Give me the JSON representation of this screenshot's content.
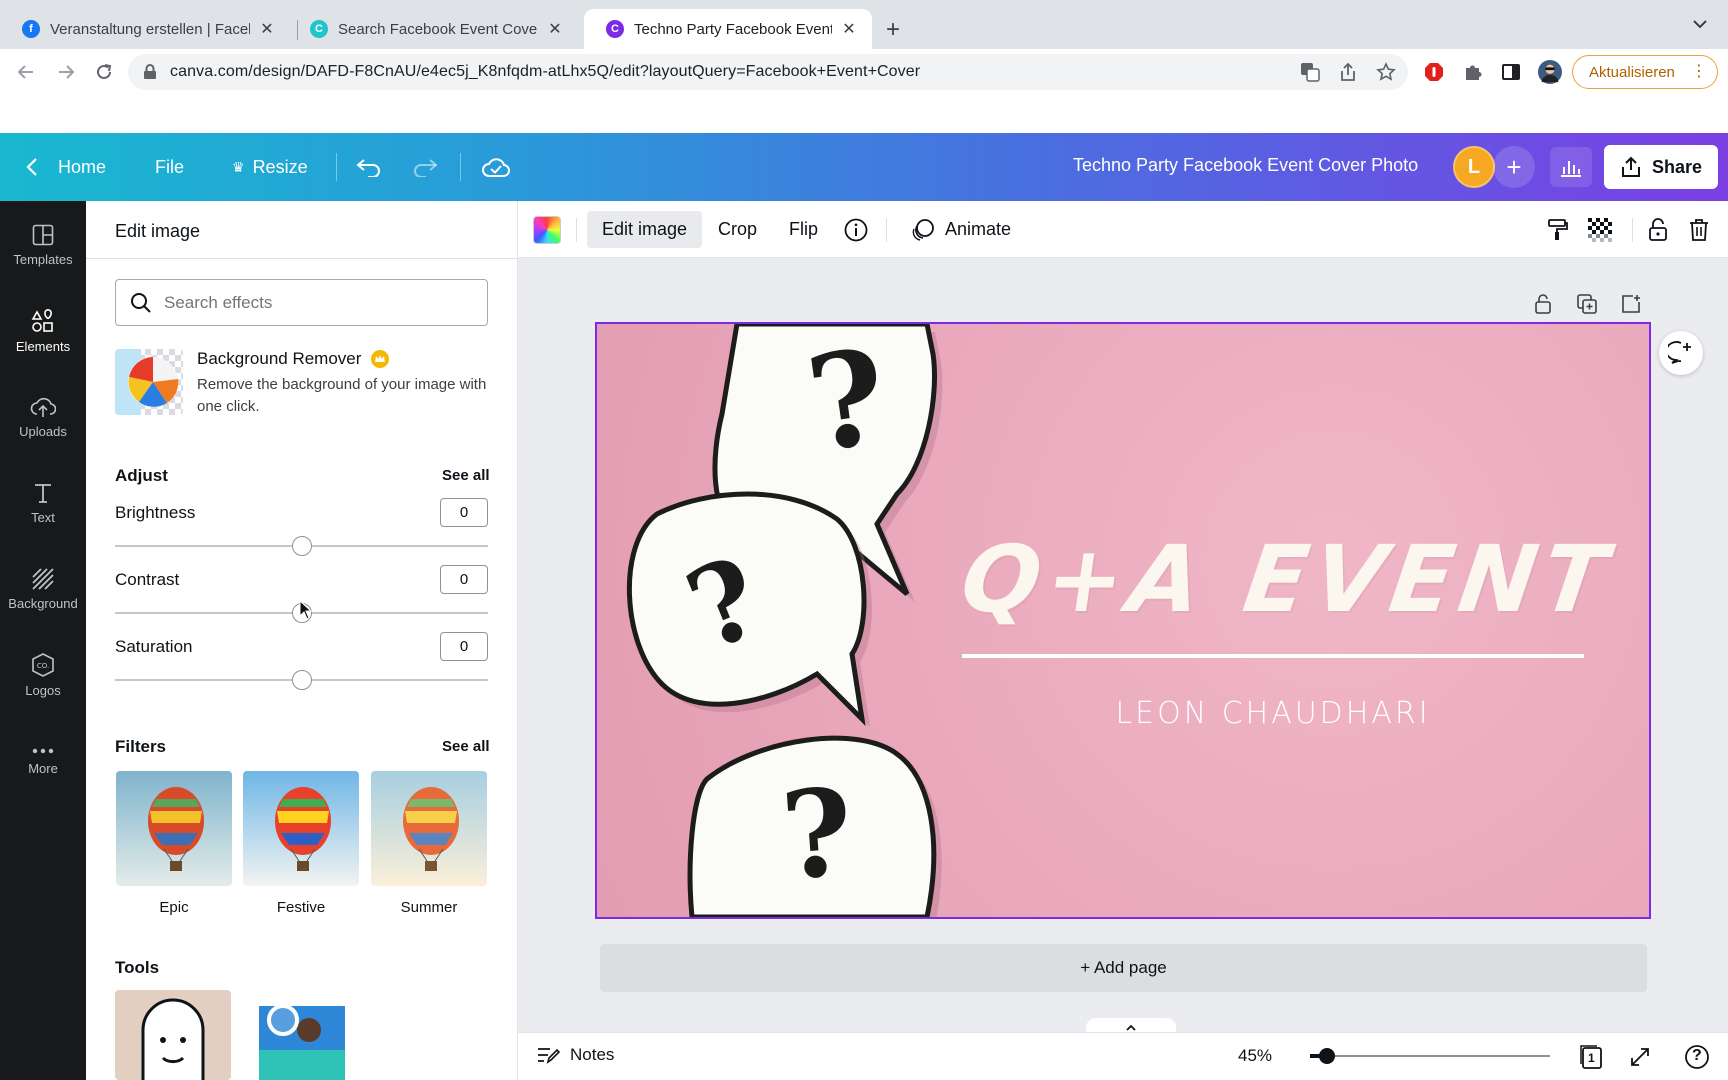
{
  "browser": {
    "tabs": [
      {
        "title": "Veranstaltung erstellen | Faceb",
        "favicon": "facebook-icon",
        "color": "#1877f2"
      },
      {
        "title": "Search Facebook Event Cover",
        "favicon": "canva-icon",
        "color": "#20c4cb"
      },
      {
        "title": "Techno Party Facebook Event C",
        "favicon": "canva-icon",
        "color": "#7d2ae8"
      }
    ],
    "url_host": "canva.com",
    "url_path": "/design/DAFD-F8CnAU/e4ec5j_K8nfqdm-atLhx5Q/edit?layoutQuery=Facebook+Event+Cover",
    "update_label": "Aktualisieren"
  },
  "header": {
    "home": "Home",
    "file": "File",
    "resize": "Resize",
    "doc_title": "Techno Party Facebook Event Cover Photo",
    "avatar_letter": "L",
    "share": "Share"
  },
  "rail": [
    {
      "label": "Templates",
      "icon": "templates-icon"
    },
    {
      "label": "Elements",
      "icon": "elements-icon"
    },
    {
      "label": "Uploads",
      "icon": "uploads-icon"
    },
    {
      "label": "Text",
      "icon": "text-icon"
    },
    {
      "label": "Background",
      "icon": "background-icon"
    },
    {
      "label": "Logos",
      "icon": "logos-icon"
    },
    {
      "label": "More",
      "icon": "more-icon"
    }
  ],
  "panel": {
    "title": "Edit image",
    "search_placeholder": "Search effects",
    "bg_remover": {
      "title": "Background Remover",
      "desc": "Remove the background of your image with one click."
    },
    "adjust": {
      "title": "Adjust",
      "see_all": "See all",
      "items": [
        {
          "label": "Brightness",
          "value": "0"
        },
        {
          "label": "Contrast",
          "value": "0"
        },
        {
          "label": "Saturation",
          "value": "0"
        }
      ]
    },
    "filters": {
      "title": "Filters",
      "see_all": "See all",
      "items": [
        "Epic",
        "Festive",
        "Summer"
      ]
    },
    "tools": {
      "title": "Tools"
    }
  },
  "toolbar": {
    "edit_image": "Edit image",
    "crop": "Crop",
    "flip": "Flip",
    "animate": "Animate"
  },
  "design": {
    "headline": "Q+A EVENT",
    "name": "LEON CHAUDHARI",
    "qmark": "?"
  },
  "canvas": {
    "add_page": "+ Add page"
  },
  "bottom": {
    "notes": "Notes",
    "zoom": "45%",
    "page_count": "1",
    "help": "?"
  }
}
